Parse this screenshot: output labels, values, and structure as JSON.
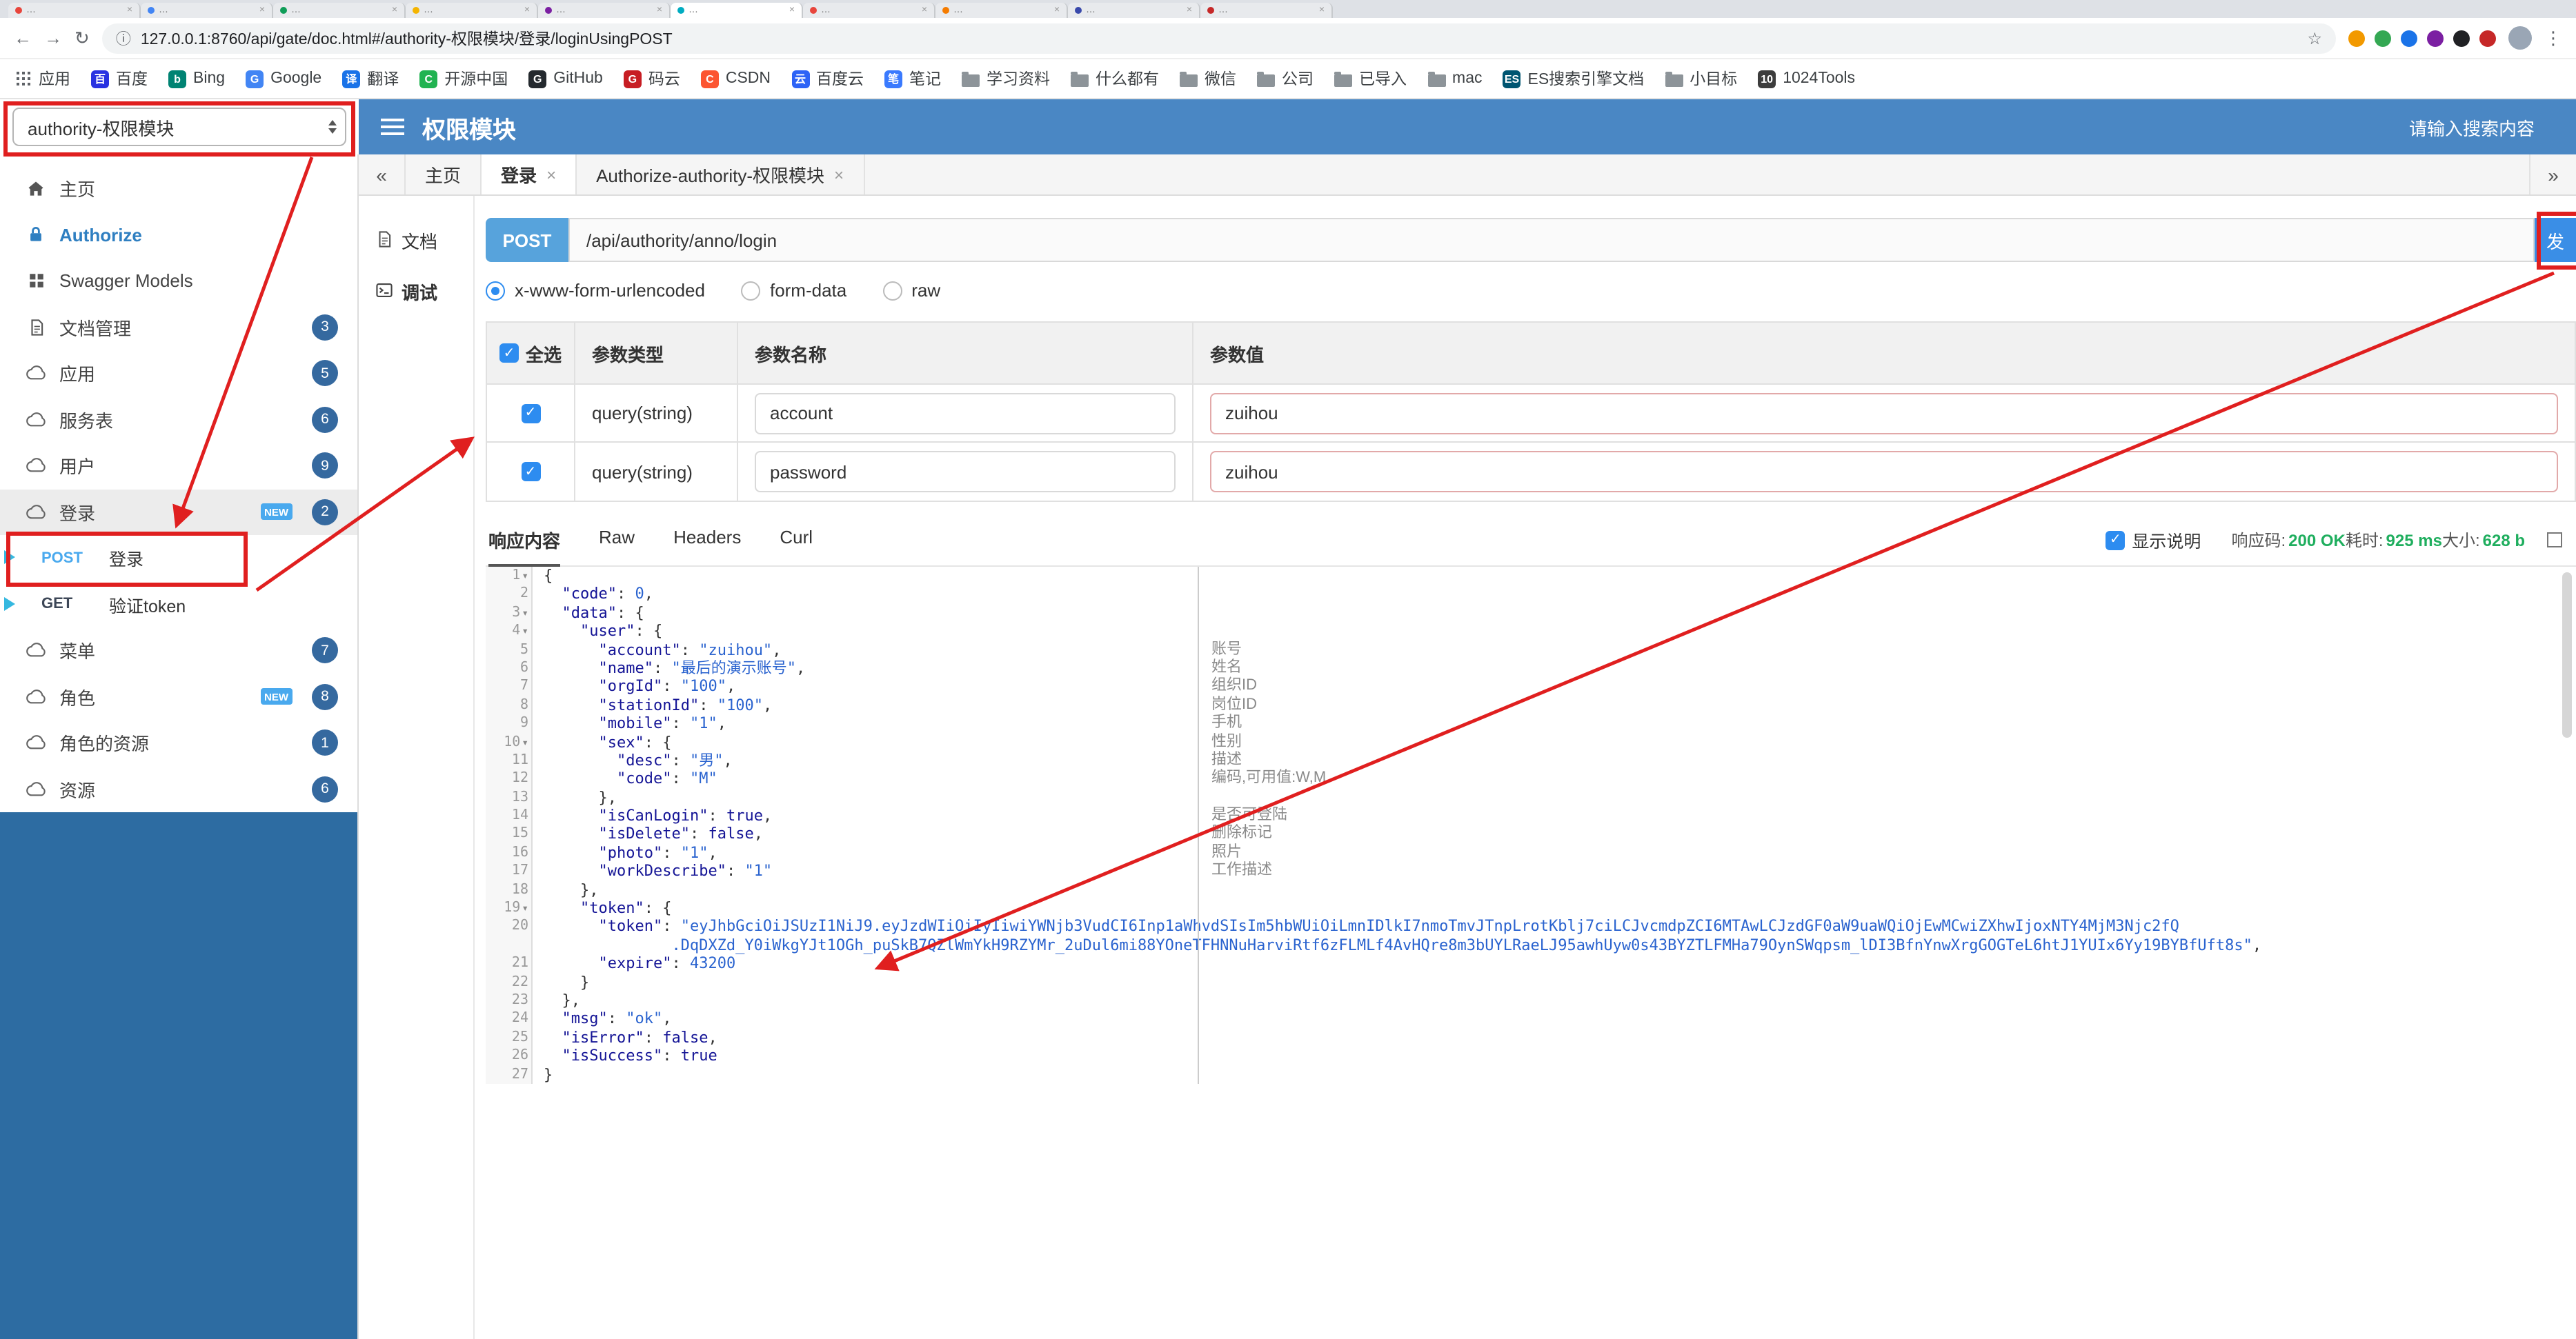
{
  "browser": {
    "tab_placeholder": "…",
    "tab_close": "×",
    "tab_colors": [
      "#e8453c",
      "#4285f4",
      "#0f9d58",
      "#f4b400",
      "#7b1fa2",
      "#00acc1",
      "#e8453c",
      "#f57c00",
      "#3949ab",
      "#c62828"
    ],
    "active_tab_index": 5,
    "nav_back": "←",
    "nav_forward": "→",
    "nav_reload": "↻",
    "info_icon": "ⓘ",
    "url": "127.0.0.1:8760/api/gate/doc.html#/authority-权限模块/登录/loginUsingPOST",
    "star": "☆",
    "menu_dots": "⋮",
    "extension_colors": [
      "#f29900",
      "#34a853",
      "#1a73e8",
      "#7b1fa2",
      "#202124",
      "#c62828"
    ],
    "bookmarks": [
      {
        "label": "应用",
        "icon": "apps"
      },
      {
        "label": "百度",
        "icon": "fav",
        "color": "#2932e1",
        "letter": "百"
      },
      {
        "label": "Bing",
        "icon": "fav",
        "color": "#008373",
        "letter": "b"
      },
      {
        "label": "Google",
        "icon": "fav",
        "color": "#4285f4",
        "letter": "G"
      },
      {
        "label": "翻译",
        "icon": "fav",
        "color": "#1a73e8",
        "letter": "译"
      },
      {
        "label": "开源中国",
        "icon": "fav",
        "color": "#21b351",
        "letter": "C"
      },
      {
        "label": "GitHub",
        "icon": "fav",
        "color": "#24292e",
        "letter": "G"
      },
      {
        "label": "码云",
        "icon": "fav",
        "color": "#c71d23",
        "letter": "G"
      },
      {
        "label": "CSDN",
        "icon": "fav",
        "color": "#fc5531",
        "letter": "C"
      },
      {
        "label": "百度云",
        "icon": "fav",
        "color": "#2d63f6",
        "letter": "云"
      },
      {
        "label": "笔记",
        "icon": "fav",
        "color": "#3a7afe",
        "letter": "笔"
      },
      {
        "label": "学习资料",
        "icon": "folder"
      },
      {
        "label": "什么都有",
        "icon": "folder"
      },
      {
        "label": "微信",
        "icon": "folder"
      },
      {
        "label": "公司",
        "icon": "folder"
      },
      {
        "label": "已导入",
        "icon": "folder"
      },
      {
        "label": "mac",
        "icon": "folder"
      },
      {
        "label": "ES搜索引擎文档",
        "icon": "fav",
        "color": "#005571",
        "letter": "ES"
      },
      {
        "label": "小目标",
        "icon": "folder"
      },
      {
        "label": "1024Tools",
        "icon": "fav",
        "color": "#3c3c3c",
        "letter": "10"
      }
    ]
  },
  "header": {
    "group_select": "authority-权限模块",
    "title": "权限模块",
    "search_placeholder": "请输入搜索内容"
  },
  "sidebar": {
    "items": [
      {
        "label": "主页",
        "icon": "home"
      },
      {
        "label": "Authorize",
        "icon": "lock",
        "accent": true
      },
      {
        "label": "Swagger Models",
        "icon": "models"
      },
      {
        "label": "文档管理",
        "icon": "doc",
        "badge": "3"
      },
      {
        "label": "应用",
        "icon": "cloud",
        "badge": "5"
      },
      {
        "label": "服务表",
        "icon": "cloud",
        "badge": "6"
      },
      {
        "label": "用户",
        "icon": "cloud",
        "badge": "9"
      },
      {
        "label": "登录",
        "icon": "cloud",
        "badge": "2",
        "new": "NEW",
        "active": true
      },
      {
        "label": "登录",
        "method": "POST"
      },
      {
        "label": "验证token",
        "method": "GET"
      },
      {
        "label": "菜单",
        "icon": "cloud",
        "badge": "7"
      },
      {
        "label": "角色",
        "icon": "cloud",
        "badge": "8",
        "new": "NEW"
      },
      {
        "label": "角色的资源",
        "icon": "cloud",
        "badge": "1"
      },
      {
        "label": "资源",
        "icon": "cloud",
        "badge": "6"
      }
    ]
  },
  "page_tabs": {
    "collapse_left": "«",
    "collapse_right": "»",
    "close_glyph": "×",
    "items": [
      {
        "label": "主页",
        "closable": false,
        "active": false
      },
      {
        "label": "登录",
        "closable": true,
        "active": true
      },
      {
        "label": "Authorize-authority-权限模块",
        "closable": true,
        "active": false
      }
    ]
  },
  "doc_tabs": {
    "doc": "文档",
    "debug": "调试"
  },
  "request": {
    "method": "POST",
    "url": "/api/authority/anno/login",
    "send_label": "发",
    "content_types": [
      "x-www-form-urlencoded",
      "form-data",
      "raw"
    ],
    "selected_content_type": "x-www-form-urlencoded"
  },
  "params": {
    "select_all": "全选",
    "check_glyph": "✓",
    "headers": [
      "参数类型",
      "参数名称",
      "参数值"
    ],
    "rows": [
      {
        "checked": true,
        "type": "query(string)",
        "name": "account",
        "value": "zuihou"
      },
      {
        "checked": true,
        "type": "query(string)",
        "name": "password",
        "value": "zuihou"
      }
    ]
  },
  "response": {
    "tabs": [
      "响应内容",
      "Raw",
      "Headers",
      "Curl"
    ],
    "active_tab": "响应内容",
    "show_desc": "显示说明",
    "check_glyph": "✓",
    "meta": {
      "code_label": "响应码:",
      "code_value": "200 OK",
      "time_label": "耗时:",
      "time_value": "925 ms",
      "size_label": "大小:",
      "size_value": "628 b"
    }
  },
  "editor": {
    "fold_glyph": "▾",
    "lines": [
      {
        "n": 1,
        "fold": true,
        "parts": [
          [
            "pt",
            "{"
          ]
        ]
      },
      {
        "n": 2,
        "parts": [
          [
            "pt",
            "  "
          ],
          [
            "ky",
            "\"code\""
          ],
          [
            "pt",
            ": "
          ],
          [
            "nu",
            "0"
          ],
          [
            "pt",
            ","
          ]
        ]
      },
      {
        "n": 3,
        "fold": true,
        "parts": [
          [
            "pt",
            "  "
          ],
          [
            "ky",
            "\"data\""
          ],
          [
            "pt",
            ": {"
          ]
        ]
      },
      {
        "n": 4,
        "fold": true,
        "parts": [
          [
            "pt",
            "    "
          ],
          [
            "ky",
            "\"user\""
          ],
          [
            "pt",
            ": {"
          ]
        ]
      },
      {
        "n": 5,
        "note": "账号",
        "parts": [
          [
            "pt",
            "      "
          ],
          [
            "ky",
            "\"account\""
          ],
          [
            "pt",
            ": "
          ],
          [
            "st",
            "\"zuihou\""
          ],
          [
            "pt",
            ","
          ]
        ]
      },
      {
        "n": 6,
        "note": "姓名",
        "parts": [
          [
            "pt",
            "      "
          ],
          [
            "ky",
            "\"name\""
          ],
          [
            "pt",
            ": "
          ],
          [
            "st",
            "\"最后的演示账号\""
          ],
          [
            "pt",
            ","
          ]
        ]
      },
      {
        "n": 7,
        "note": "组织ID",
        "parts": [
          [
            "pt",
            "      "
          ],
          [
            "ky",
            "\"orgId\""
          ],
          [
            "pt",
            ": "
          ],
          [
            "st",
            "\"100\""
          ],
          [
            "pt",
            ","
          ]
        ]
      },
      {
        "n": 8,
        "note": "岗位ID",
        "parts": [
          [
            "pt",
            "      "
          ],
          [
            "ky",
            "\"stationId\""
          ],
          [
            "pt",
            ": "
          ],
          [
            "st",
            "\"100\""
          ],
          [
            "pt",
            ","
          ]
        ]
      },
      {
        "n": 9,
        "note": "手机",
        "parts": [
          [
            "pt",
            "      "
          ],
          [
            "ky",
            "\"mobile\""
          ],
          [
            "pt",
            ": "
          ],
          [
            "st",
            "\"1\""
          ],
          [
            "pt",
            ","
          ]
        ]
      },
      {
        "n": 10,
        "fold": true,
        "note": "性别",
        "parts": [
          [
            "pt",
            "      "
          ],
          [
            "ky",
            "\"sex\""
          ],
          [
            "pt",
            ": {"
          ]
        ]
      },
      {
        "n": 11,
        "note": "描述",
        "parts": [
          [
            "pt",
            "        "
          ],
          [
            "ky",
            "\"desc\""
          ],
          [
            "pt",
            ": "
          ],
          [
            "st",
            "\"男\""
          ],
          [
            "pt",
            ","
          ]
        ]
      },
      {
        "n": 12,
        "note": "编码,可用值:W,M",
        "parts": [
          [
            "pt",
            "        "
          ],
          [
            "ky",
            "\"code\""
          ],
          [
            "pt",
            ": "
          ],
          [
            "st",
            "\"M\""
          ]
        ]
      },
      {
        "n": 13,
        "parts": [
          [
            "pt",
            "      },"
          ]
        ]
      },
      {
        "n": 14,
        "note": "是否可登陆",
        "parts": [
          [
            "pt",
            "      "
          ],
          [
            "ky",
            "\"isCanLogin\""
          ],
          [
            "pt",
            ": "
          ],
          [
            "bo",
            "true"
          ],
          [
            "pt",
            ","
          ]
        ]
      },
      {
        "n": 15,
        "note": "删除标记",
        "parts": [
          [
            "pt",
            "      "
          ],
          [
            "ky",
            "\"isDelete\""
          ],
          [
            "pt",
            ": "
          ],
          [
            "bo",
            "false"
          ],
          [
            "pt",
            ","
          ]
        ]
      },
      {
        "n": 16,
        "note": "照片",
        "parts": [
          [
            "pt",
            "      "
          ],
          [
            "ky",
            "\"photo\""
          ],
          [
            "pt",
            ": "
          ],
          [
            "st",
            "\"1\""
          ],
          [
            "pt",
            ","
          ]
        ]
      },
      {
        "n": 17,
        "note": "工作描述",
        "parts": [
          [
            "pt",
            "      "
          ],
          [
            "ky",
            "\"workDescribe\""
          ],
          [
            "pt",
            ": "
          ],
          [
            "st",
            "\"1\""
          ]
        ]
      },
      {
        "n": 18,
        "parts": [
          [
            "pt",
            "    },"
          ]
        ]
      },
      {
        "n": 19,
        "fold": true,
        "parts": [
          [
            "pt",
            "    "
          ],
          [
            "ky",
            "\"token\""
          ],
          [
            "pt",
            ": {"
          ]
        ]
      },
      {
        "n": 20,
        "parts": [
          [
            "pt",
            "      "
          ],
          [
            "ky",
            "\"token\""
          ],
          [
            "pt",
            ": "
          ],
          [
            "st",
            "\"eyJhbGciOiJSUzI1NiJ9.eyJzdWIiOiIyIiwiYWNjb3VudCI6Inp1aWhvdSIsIm5hbWUiOiLmnIDlkI7nmoTmvJTnpLrotKblj7ciLCJvcmdpZCI6MTAwLCJzdGF0aW9uaWQiOjEwMCwiZXhwIjoxNTY4MjM3Njc2fQ"
          ]
        ]
      },
      {
        "n": null,
        "parts": [
          [
            "pt",
            "              "
          ],
          [
            "st",
            ".DqDXZd_Y0iWkgYJt1OGh_puSkB7QZlWmYkH9RZYMr_2uDul6mi88YOneTFHNNuHarviRtf6zFLMLf4AvHQre8m3bUYLRaeLJ95awhUyw0s43BYZTLFMHa79OynSWqpsm_lDI3BfnYnwXrgGOGTeL6htJ1YUIx6Yy19BYBfUft8s\""
          ],
          [
            "pt",
            ","
          ]
        ]
      },
      {
        "n": 21,
        "parts": [
          [
            "pt",
            "      "
          ],
          [
            "ky",
            "\"expire\""
          ],
          [
            "pt",
            ": "
          ],
          [
            "nu",
            "43200"
          ]
        ]
      },
      {
        "n": 22,
        "parts": [
          [
            "pt",
            "    }"
          ]
        ]
      },
      {
        "n": 23,
        "parts": [
          [
            "pt",
            "  },"
          ]
        ]
      },
      {
        "n": 24,
        "parts": [
          [
            "pt",
            "  "
          ],
          [
            "ky",
            "\"msg\""
          ],
          [
            "pt",
            ": "
          ],
          [
            "st",
            "\"ok\""
          ],
          [
            "pt",
            ","
          ]
        ]
      },
      {
        "n": 25,
        "parts": [
          [
            "pt",
            "  "
          ],
          [
            "ky",
            "\"isError\""
          ],
          [
            "pt",
            ": "
          ],
          [
            "bo",
            "false"
          ],
          [
            "pt",
            ","
          ]
        ]
      },
      {
        "n": 26,
        "parts": [
          [
            "pt",
            "  "
          ],
          [
            "ky",
            "\"isSuccess\""
          ],
          [
            "pt",
            ": "
          ],
          [
            "bo",
            "true"
          ]
        ]
      },
      {
        "n": 27,
        "parts": [
          [
            "pt",
            "}"
          ]
        ]
      }
    ]
  }
}
